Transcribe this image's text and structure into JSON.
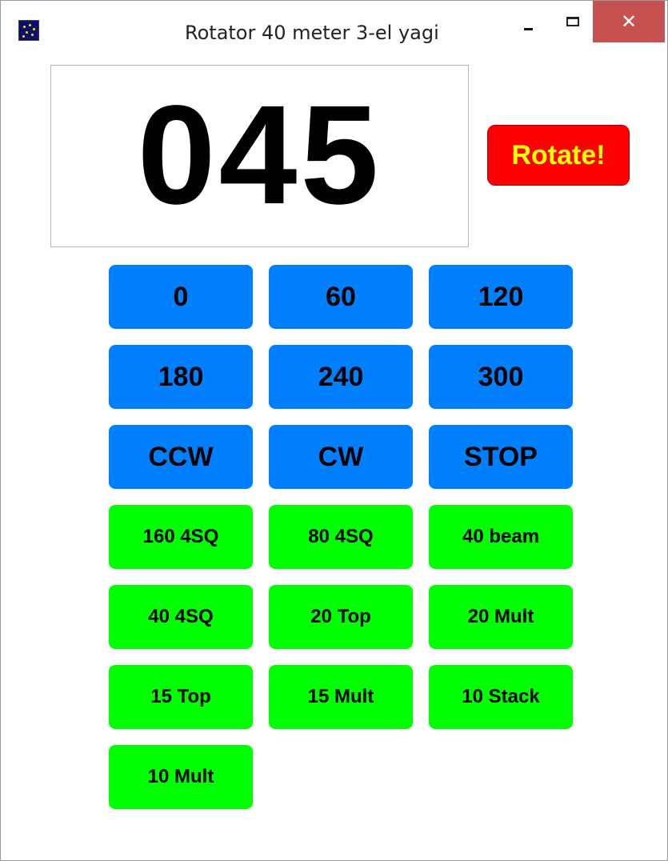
{
  "window": {
    "title": "Rotator 40 meter 3-el yagi",
    "close_glyph": "✕"
  },
  "display": {
    "heading": "045"
  },
  "rotate_button": {
    "label": "Rotate!"
  },
  "heading_buttons": [
    "0",
    "60",
    "120",
    "180",
    "240",
    "300"
  ],
  "control_buttons": [
    "CCW",
    "CW",
    "STOP"
  ],
  "antenna_buttons": [
    "160 4SQ",
    "80 4SQ",
    "40 beam",
    "40 4SQ",
    "20 Top",
    "20 Mult",
    "15 Top",
    "15 Mult",
    "10 Stack",
    "10 Mult"
  ],
  "colors": {
    "blue_button": "#0080ff",
    "green_button": "#00ff00",
    "rotate_bg": "#ff0000",
    "rotate_text": "#ffff00",
    "close_bg": "#c75050"
  }
}
